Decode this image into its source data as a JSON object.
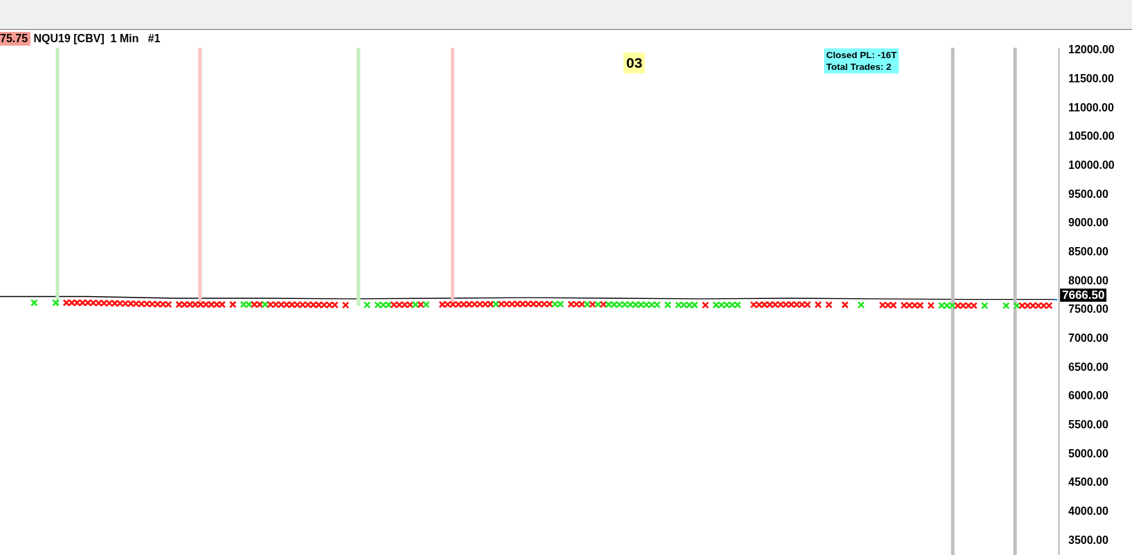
{
  "header": {
    "last_price": "75.75",
    "symbol": "NQU19 [CBV]",
    "interval": "1 Min",
    "chart_number": "#1"
  },
  "session_badge": "03",
  "stats": [
    "Closed PL: -16T",
    "Total Trades: 2"
  ],
  "signal_lines": [
    {
      "kind": "long"
    },
    {
      "kind": "short"
    },
    {
      "kind": "long"
    },
    {
      "kind": "short"
    },
    {
      "kind": "exit"
    },
    {
      "kind": "exit"
    }
  ],
  "current_price": "7666.50",
  "chart_data": {
    "type": "line",
    "yticks": [
      {
        "value": 12000,
        "label": "12000.00"
      },
      {
        "value": 11500,
        "label": "11500.00"
      },
      {
        "value": 11000,
        "label": "11000.00"
      },
      {
        "value": 10500,
        "label": "10500.00"
      },
      {
        "value": 10000,
        "label": "10000.00"
      },
      {
        "value": 9500,
        "label": "9500.00"
      },
      {
        "value": 9000,
        "label": "9000.00"
      },
      {
        "value": 8500,
        "label": "8500.00"
      },
      {
        "value": 8000,
        "label": "8000.00"
      },
      {
        "value": 7500,
        "label": "7500.00"
      },
      {
        "value": 7000,
        "label": "7000.00"
      },
      {
        "value": 6500,
        "label": "6500.00"
      },
      {
        "value": 6000,
        "label": "6000.00"
      },
      {
        "value": 5500,
        "label": "5500.00"
      },
      {
        "value": 5000,
        "label": "5000.00"
      },
      {
        "value": 4500,
        "label": "4500.00"
      },
      {
        "value": 4000,
        "label": "4000.00"
      },
      {
        "value": 3500,
        "label": "3500.00"
      }
    ],
    "ylim": [
      3250,
      12050
    ],
    "series": [
      {
        "color": "#000000",
        "values": [
          7720,
          7720,
          7690,
          7690,
          7680,
          7690,
          7700,
          7690,
          7680,
          7690,
          7680,
          7670,
          7670
        ]
      }
    ]
  }
}
